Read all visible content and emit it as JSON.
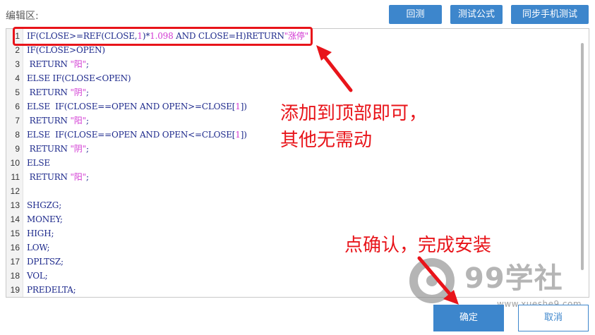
{
  "header": {
    "editor_label": "编辑区:",
    "backtest_label": "回测",
    "test_formula_label": "测试公式",
    "sync_mobile_label": "同步手机测试"
  },
  "editor": {
    "lines": [
      {
        "no": "1",
        "parts": [
          {
            "t": "IF(CLOSE>=REF(CLOSE,",
            "c": "kw"
          },
          {
            "t": "1",
            "c": "num"
          },
          {
            "t": ")*",
            "c": "kw"
          },
          {
            "t": "1.098",
            "c": "num"
          },
          {
            "t": " AND CLOSE=H)RETURN",
            "c": "kw"
          },
          {
            "t": "\"涨停\"",
            "c": "str"
          }
        ]
      },
      {
        "no": "2",
        "parts": [
          {
            "t": "IF(CLOSE>OPEN)",
            "c": "kw"
          }
        ]
      },
      {
        "no": "3",
        "parts": [
          {
            "t": " RETURN ",
            "c": "kw"
          },
          {
            "t": "\"阳\"",
            "c": "str"
          },
          {
            "t": ";",
            "c": "kw"
          }
        ]
      },
      {
        "no": "4",
        "parts": [
          {
            "t": "ELSE IF(CLOSE<OPEN)",
            "c": "kw"
          }
        ]
      },
      {
        "no": "5",
        "parts": [
          {
            "t": " RETURN ",
            "c": "kw"
          },
          {
            "t": "\"阴\"",
            "c": "str"
          },
          {
            "t": ";",
            "c": "kw"
          }
        ]
      },
      {
        "no": "6",
        "parts": [
          {
            "t": "ELSE  IF(CLOSE==OPEN AND OPEN>=CLOSE[",
            "c": "kw"
          },
          {
            "t": "1",
            "c": "num"
          },
          {
            "t": "])",
            "c": "kw"
          }
        ]
      },
      {
        "no": "7",
        "parts": [
          {
            "t": " RETURN ",
            "c": "kw"
          },
          {
            "t": "\"阳\"",
            "c": "str"
          },
          {
            "t": ";",
            "c": "kw"
          }
        ]
      },
      {
        "no": "8",
        "parts": [
          {
            "t": "ELSE  IF(CLOSE==OPEN AND OPEN<=CLOSE[",
            "c": "kw"
          },
          {
            "t": "1",
            "c": "num"
          },
          {
            "t": "])",
            "c": "kw"
          }
        ]
      },
      {
        "no": "9",
        "parts": [
          {
            "t": " RETURN ",
            "c": "kw"
          },
          {
            "t": "\"阴\"",
            "c": "str"
          },
          {
            "t": ";",
            "c": "kw"
          }
        ]
      },
      {
        "no": "10",
        "parts": [
          {
            "t": "ELSE",
            "c": "kw"
          }
        ]
      },
      {
        "no": "11",
        "parts": [
          {
            "t": " RETURN ",
            "c": "kw"
          },
          {
            "t": "\"阳\"",
            "c": "str"
          },
          {
            "t": ";",
            "c": "kw"
          }
        ]
      },
      {
        "no": "12",
        "parts": []
      },
      {
        "no": "13",
        "parts": [
          {
            "t": "SHGZG;",
            "c": "kw"
          }
        ]
      },
      {
        "no": "14",
        "parts": [
          {
            "t": "MONEY;",
            "c": "kw"
          }
        ]
      },
      {
        "no": "15",
        "parts": [
          {
            "t": "HIGH;",
            "c": "kw"
          }
        ]
      },
      {
        "no": "16",
        "parts": [
          {
            "t": "LOW;",
            "c": "kw"
          }
        ]
      },
      {
        "no": "17",
        "parts": [
          {
            "t": "DPLTSZ;",
            "c": "kw"
          }
        ]
      },
      {
        "no": "18",
        "parts": [
          {
            "t": "VOL;",
            "c": "kw"
          }
        ]
      },
      {
        "no": "19",
        "parts": [
          {
            "t": "PREDELTA;",
            "c": "kw"
          }
        ]
      }
    ]
  },
  "annotations": {
    "line1": "添加到顶部即可，",
    "line2": "其他无需动",
    "confirm_hint": "点确认，完成安装"
  },
  "watermark": {
    "brand": "99学社",
    "url": "www.xueshe9.com"
  },
  "footer": {
    "ok_label": "确定",
    "cancel_label": "取消"
  },
  "colors": {
    "accent": "#3d86cc",
    "annotation_red": "#e8141a",
    "code_keyword": "#1e2a8c",
    "code_string": "#d23ad3"
  }
}
